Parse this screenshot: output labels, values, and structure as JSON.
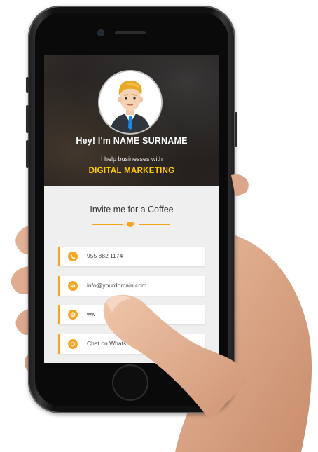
{
  "profile": {
    "name": "Hey! I'm NAME SURNAME",
    "tagline": "I help businesses with",
    "specialty": "DIGITAL MARKETING"
  },
  "section": {
    "title": "Invite me for a Coffee"
  },
  "contacts": [
    {
      "icon": "phone-icon",
      "label": "955 882 1174"
    },
    {
      "icon": "mail-icon",
      "label": "info@yourdomain.com"
    },
    {
      "icon": "globe-icon",
      "label": "ww"
    },
    {
      "icon": "whatsapp-icon",
      "label": "Chat on Whats"
    }
  ],
  "colors": {
    "accent": "#f6a623",
    "highlight": "#ffcc00",
    "background": "#efefef"
  }
}
